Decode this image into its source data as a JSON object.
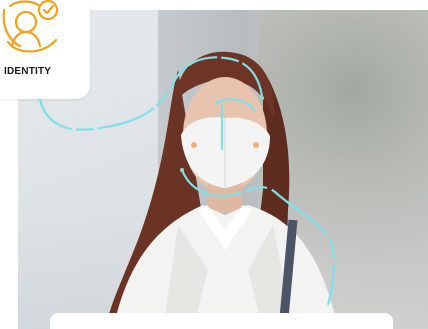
{
  "badge": {
    "label": "IDENTITY",
    "icon": "identity-user-check-icon"
  },
  "colors": {
    "accent": "#F0A21E",
    "tracking_lines": "#7FE0E8",
    "badge_bg": "#FFFFFF"
  }
}
